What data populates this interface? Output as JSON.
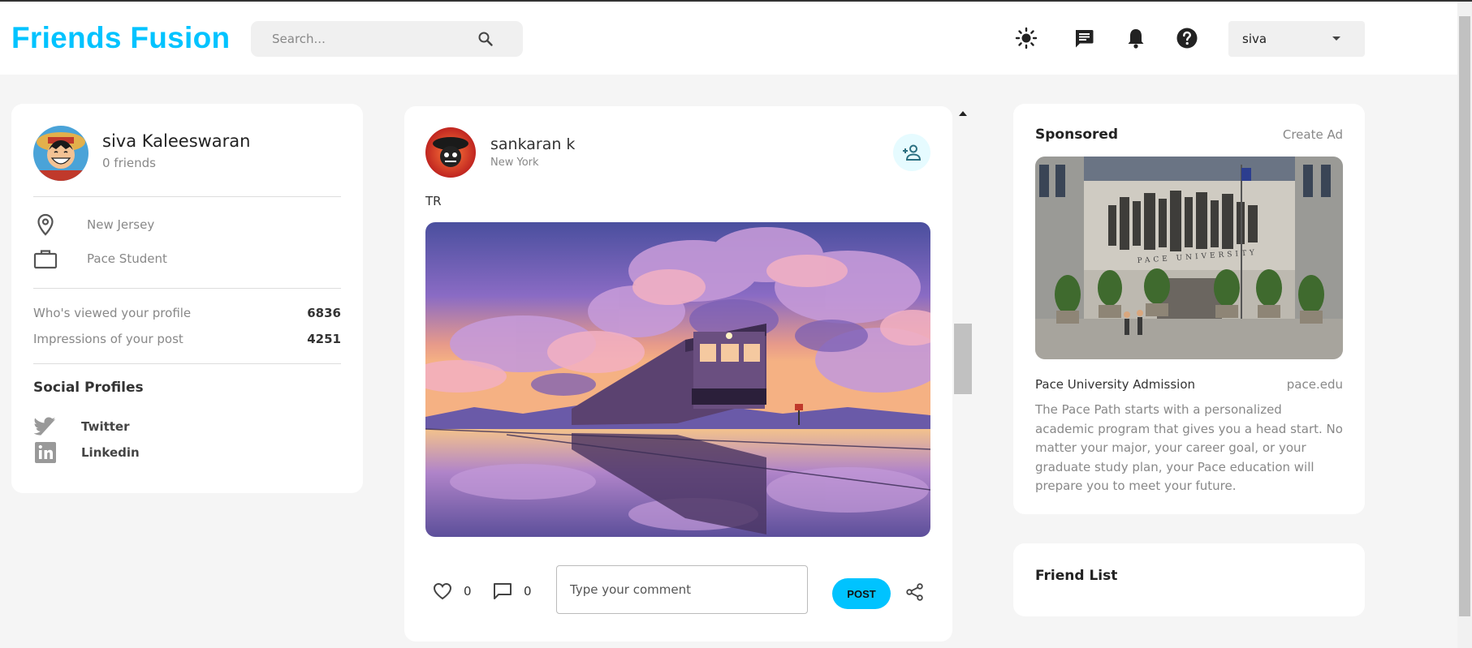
{
  "app": {
    "title": "Friends Fusion",
    "accent_color": "#00c3ff"
  },
  "search": {
    "placeholder": "Search...",
    "icon": "search-icon"
  },
  "navbar": {
    "icons": [
      "light-mode-icon",
      "message-icon",
      "notification-bell-icon",
      "help-icon"
    ],
    "user_select": {
      "value": "siva"
    }
  },
  "profile": {
    "name": "siva Kaleeswaran",
    "friends": "0 friends",
    "location": "New Jersey",
    "occupation": "Pace Student",
    "stats": [
      {
        "label": "Who's viewed your profile",
        "value": "6836"
      },
      {
        "label": "Impressions of your post",
        "value": "4251"
      }
    ],
    "social_title": "Social Profiles",
    "socials": [
      {
        "name": "Twitter",
        "icon": "twitter-icon"
      },
      {
        "name": "Linkedin",
        "icon": "linkedin-icon"
      }
    ]
  },
  "post": {
    "author": "sankaran k",
    "location": "New York",
    "text": "TR",
    "likes": "0",
    "comments": "0",
    "comment_placeholder": "Type your comment",
    "post_button": "POST"
  },
  "sponsored": {
    "title": "Sponsored",
    "create_ad": "Create Ad",
    "name": "Pace University Admission",
    "site": "pace.edu",
    "description": "The Pace Path starts with a personalized academic program that gives you a head start. No matter your major, your career goal, or your graduate study plan, your Pace education will prepare you to meet your future.",
    "image_sign": "PACE UNIVERSITY"
  },
  "friend_list": {
    "title": "Friend List"
  }
}
